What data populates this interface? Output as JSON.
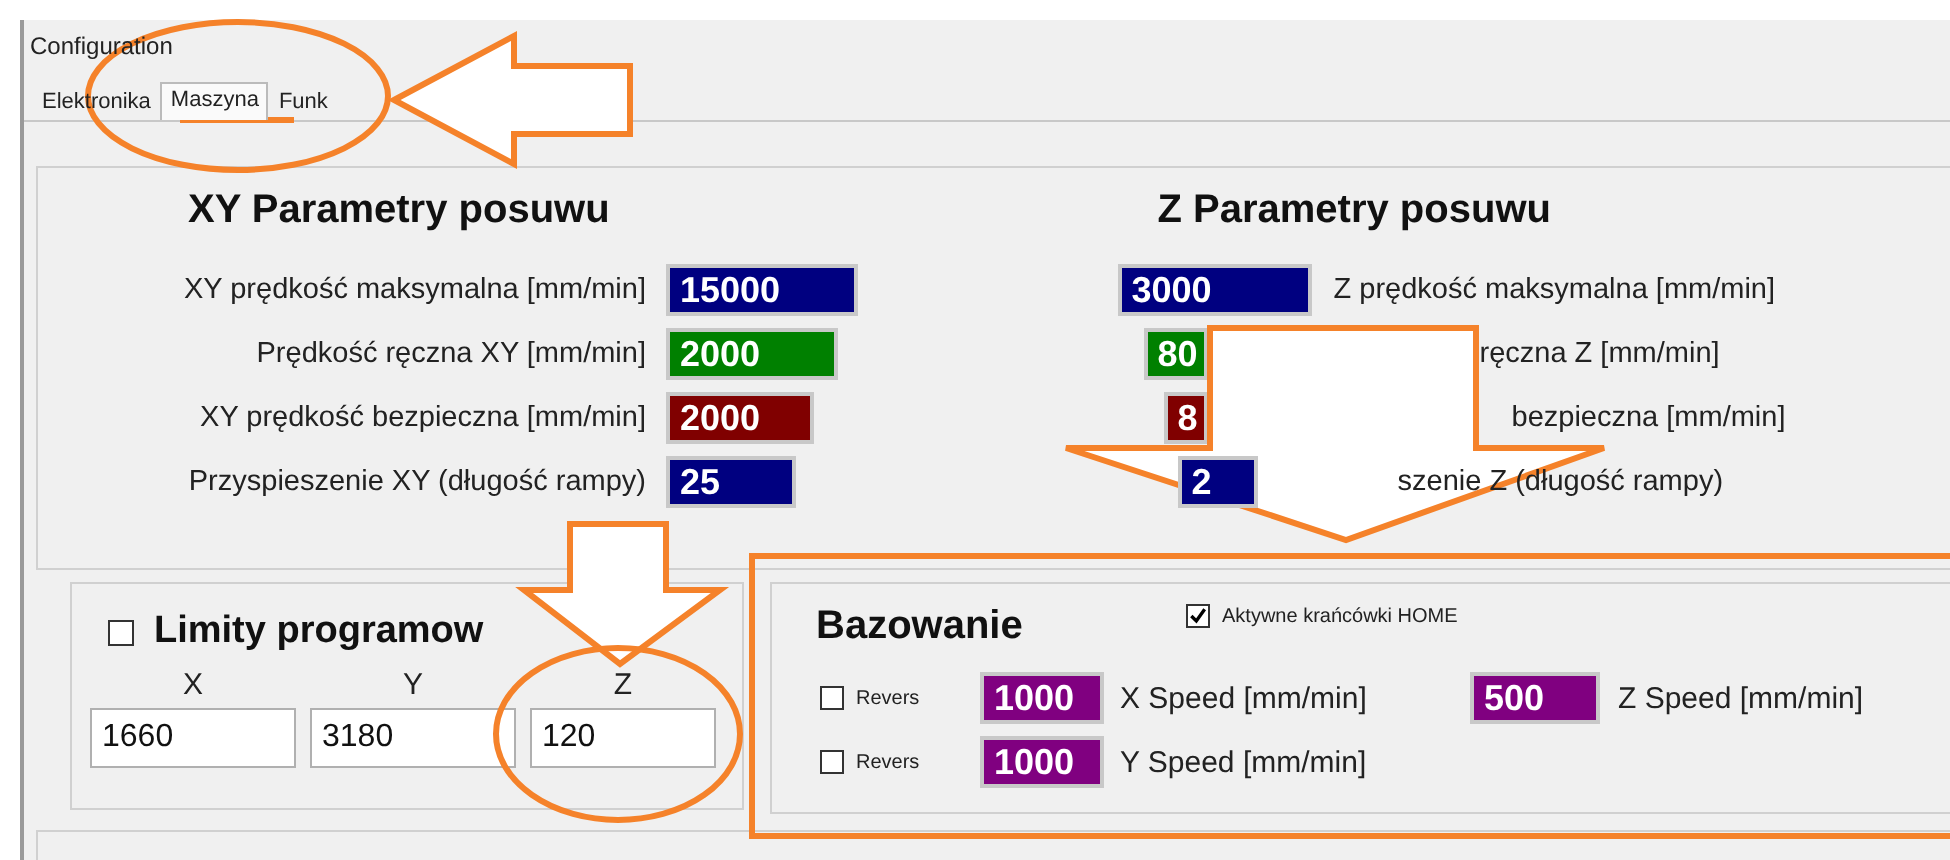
{
  "window": {
    "title": "Configuration"
  },
  "tabs": [
    {
      "label": "Elektronika",
      "selected": false
    },
    {
      "label": "Maszyna",
      "selected": true
    },
    {
      "label": "Funk",
      "selected": false
    }
  ],
  "xy_feed": {
    "title": "XY Parametry posuwu",
    "rows": [
      {
        "label": "XY prędkość maksymalna [mm/min]",
        "value": "15000",
        "color": "#000080"
      },
      {
        "label": "Prędkość ręczna XY [mm/min]",
        "value": "2000",
        "color": "#008000"
      },
      {
        "label": "XY prędkość bezpieczna [mm/min]",
        "value": "2000",
        "color": "#800000"
      },
      {
        "label": "Przyspieszenie XY (długość rampy)",
        "value": "25",
        "color": "#000080"
      }
    ]
  },
  "z_feed": {
    "title": "Z Parametry posuwu",
    "rows": [
      {
        "label": "Z prędkość maksymalna [mm/min]",
        "value": "3000",
        "color": "#000080"
      },
      {
        "label": "ręczna Z [mm/min]",
        "value": "80",
        "color": "#008000"
      },
      {
        "label": "bezpieczna [mm/min]",
        "value": "8",
        "color": "#800000"
      },
      {
        "label": "szenie Z (długość rampy)",
        "value": "2",
        "color": "#000080"
      }
    ]
  },
  "soft_limits": {
    "title": "Limity programow",
    "checked": false,
    "axes": [
      {
        "label": "X",
        "value": "1660"
      },
      {
        "label": "Y",
        "value": "3180"
      },
      {
        "label": "Z",
        "value": "120"
      }
    ]
  },
  "homing": {
    "title": "Bazowanie",
    "home_switches": {
      "label": "Aktywne krańcówki HOME",
      "checked": true
    },
    "axes": [
      {
        "reverse_label": "Revers",
        "reverse_checked": false,
        "value": "1000",
        "color": "#800080",
        "label": "X Speed [mm/min]"
      },
      {
        "reverse_label": "Revers",
        "reverse_checked": false,
        "value": "1000",
        "color": "#800080",
        "label": "Y Speed [mm/min]"
      },
      {
        "value": "500",
        "color": "#800080",
        "label": "Z Speed [mm/min]"
      }
    ]
  }
}
